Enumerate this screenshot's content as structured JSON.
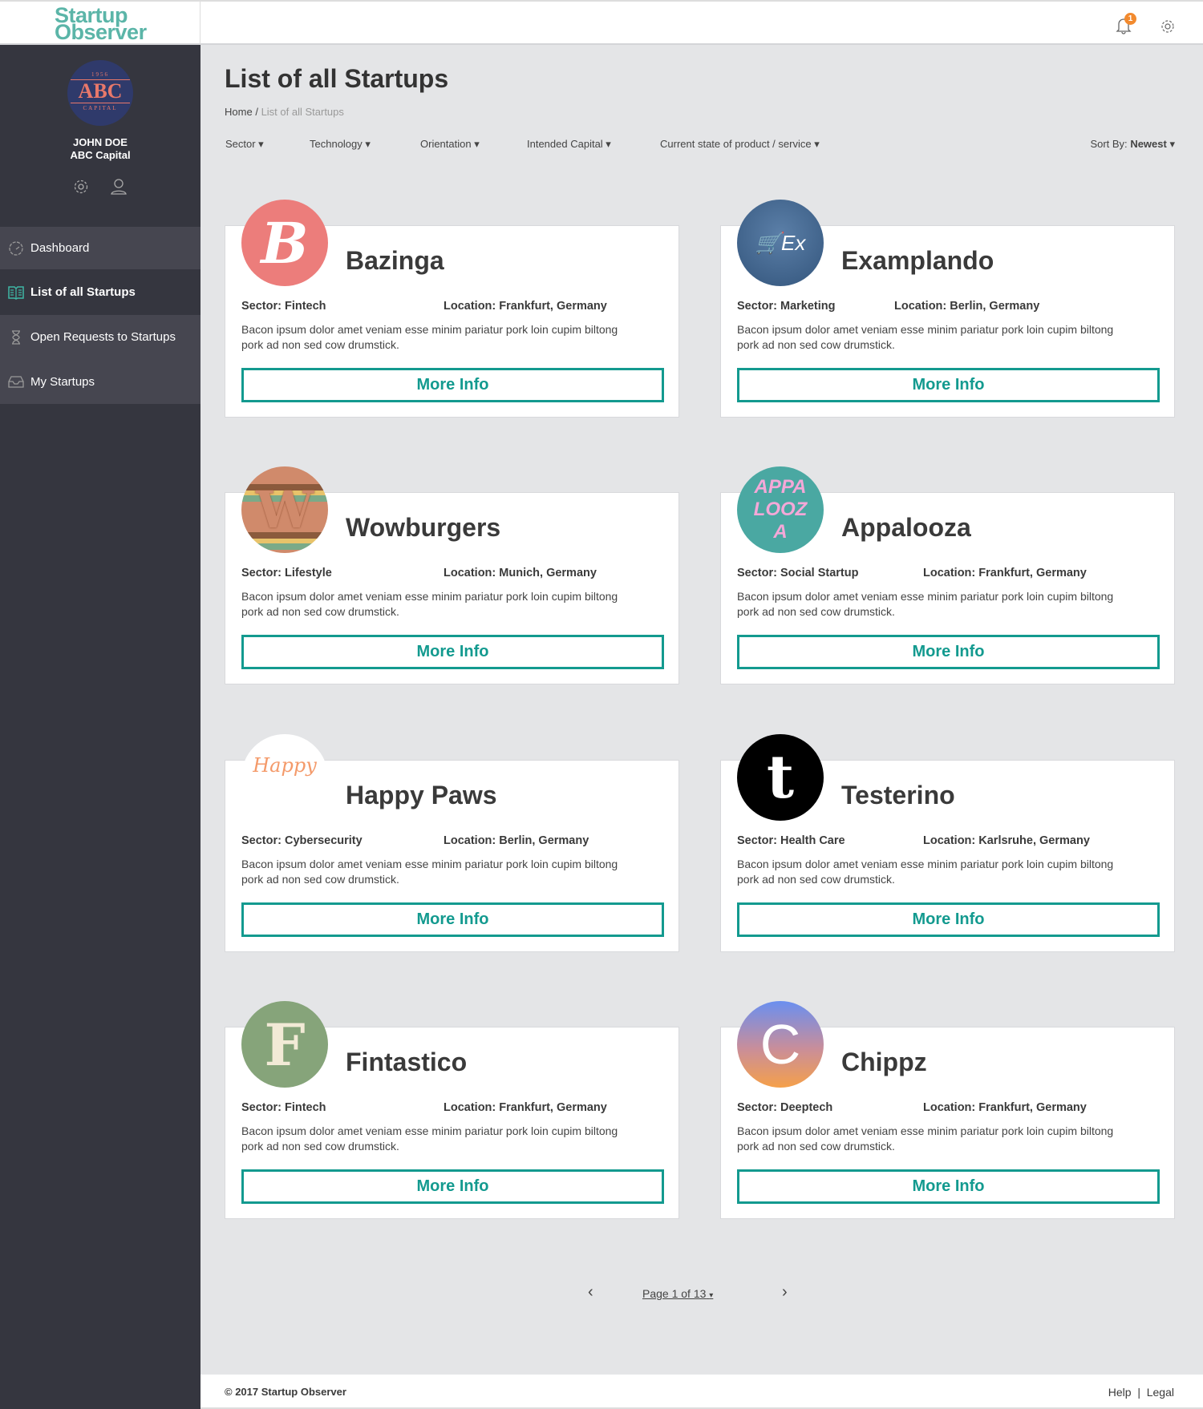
{
  "app": {
    "logo_line1": "Startup",
    "logo_line2": "Observer",
    "notification_count": "1",
    "accent": "#139a8f",
    "brand": "#5bb5a8"
  },
  "user": {
    "name": "JOHN DOE",
    "org": "ABC Capital",
    "avatar": {
      "year": "1956",
      "mark": "ABC",
      "sub": "CAPITAL"
    }
  },
  "sidebar": {
    "items": [
      {
        "label": "Dashboard",
        "icon": "gauge-icon"
      },
      {
        "label": "List of all Startups",
        "icon": "book-icon",
        "active": true
      },
      {
        "label": "Open Requests to Startups",
        "icon": "hourglass-icon"
      },
      {
        "label": "My Startups",
        "icon": "inbox-icon"
      }
    ]
  },
  "page": {
    "title": "List of all Startups",
    "breadcrumb": {
      "home": "Home",
      "sep": "/",
      "current": "List of all Startups"
    }
  },
  "filters": [
    "Sector ▾",
    "Technology ▾",
    "Orientation ▾",
    "Intended Capital ▾",
    "Current state of product / service ▾"
  ],
  "sort": {
    "label": "Sort By:",
    "value": "Newest",
    "arrow": "▾"
  },
  "startups": [
    {
      "name": "Bazinga",
      "sector": "Sector: Fintech",
      "location": "Location: Frankfurt, Germany",
      "desc": "Bacon ipsum dolor amet veniam esse minim pariatur pork loin cupim biltong pork ad non sed cow drumstick.",
      "button": "More Info",
      "logo_text": "B"
    },
    {
      "name": "Examplando",
      "sector": "Sector: Marketing",
      "location": "Location: Berlin, Germany",
      "desc": "Bacon ipsum dolor amet veniam esse minim pariatur pork loin cupim biltong pork ad non sed cow drumstick.",
      "button": "More Info",
      "logo_text": "Ex"
    },
    {
      "name": "Wowburgers",
      "sector": "Sector: Lifestyle",
      "location": "Location: Munich, Germany",
      "desc": "Bacon ipsum dolor amet veniam esse minim pariatur pork loin cupim biltong pork ad non sed cow drumstick.",
      "button": "More Info",
      "logo_text": "W"
    },
    {
      "name": "Appalooza",
      "sector": "Sector: Social Startup",
      "location": "Location: Frankfurt, Germany",
      "desc": "Bacon ipsum dolor amet veniam esse minim pariatur pork loin cupim biltong pork ad non sed cow drumstick.",
      "button": "More Info",
      "logo_text": "APPA LOOZA"
    },
    {
      "name": "Happy Paws",
      "sector": "Sector: Cybersecurity",
      "location": "Location: Berlin, Germany",
      "desc": "Bacon ipsum dolor amet veniam esse minim pariatur pork loin cupim biltong pork ad non sed cow drumstick.",
      "button": "More Info",
      "logo_text": "Happy"
    },
    {
      "name": "Testerino",
      "sector": "Sector: Health Care",
      "location": "Location: Karlsruhe, Germany",
      "desc": "Bacon ipsum dolor amet veniam esse minim pariatur pork loin cupim biltong pork ad non sed cow drumstick.",
      "button": "More Info",
      "logo_text": "t"
    },
    {
      "name": "Fintastico",
      "sector": "Sector: Fintech",
      "location": "Location: Frankfurt, Germany",
      "desc": "Bacon ipsum dolor amet veniam esse minim pariatur pork loin cupim biltong pork ad non sed cow drumstick.",
      "button": "More Info",
      "logo_text": "F"
    },
    {
      "name": "Chippz",
      "sector": "Sector: Deeptech",
      "location": "Location: Frankfurt, Germany",
      "desc": "Bacon ipsum dolor amet veniam esse minim pariatur pork loin cupim biltong pork ad non sed cow drumstick.",
      "button": "More Info",
      "logo_text": "C"
    }
  ],
  "pagination": {
    "prev": "‹",
    "label": "Page 1 of 13",
    "arrow": "▾",
    "next": "›",
    "current": 1,
    "total": 13
  },
  "footer": {
    "copyright": "© 2017 Startup Observer",
    "help": "Help",
    "sep": "|",
    "legal": "Legal"
  }
}
